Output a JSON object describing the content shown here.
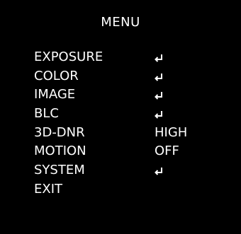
{
  "menu": {
    "title": "MENU",
    "items": [
      {
        "label": "EXPOSURE",
        "value": "",
        "icon": "enter-return-icon"
      },
      {
        "label": "COLOR",
        "value": "",
        "icon": "enter-return-icon"
      },
      {
        "label": "IMAGE",
        "value": "",
        "icon": "enter-return-icon"
      },
      {
        "label": "BLC",
        "value": "",
        "icon": "enter-return-icon"
      },
      {
        "label": "3D-DNR",
        "value": "HIGH"
      },
      {
        "label": "MOTION",
        "value": "OFF"
      },
      {
        "label": "SYSTEM",
        "value": "",
        "icon": "enter-return-icon"
      },
      {
        "label": "EXIT",
        "value": ""
      }
    ]
  },
  "colors": {
    "background": "#000000",
    "text": "#ffffff"
  }
}
